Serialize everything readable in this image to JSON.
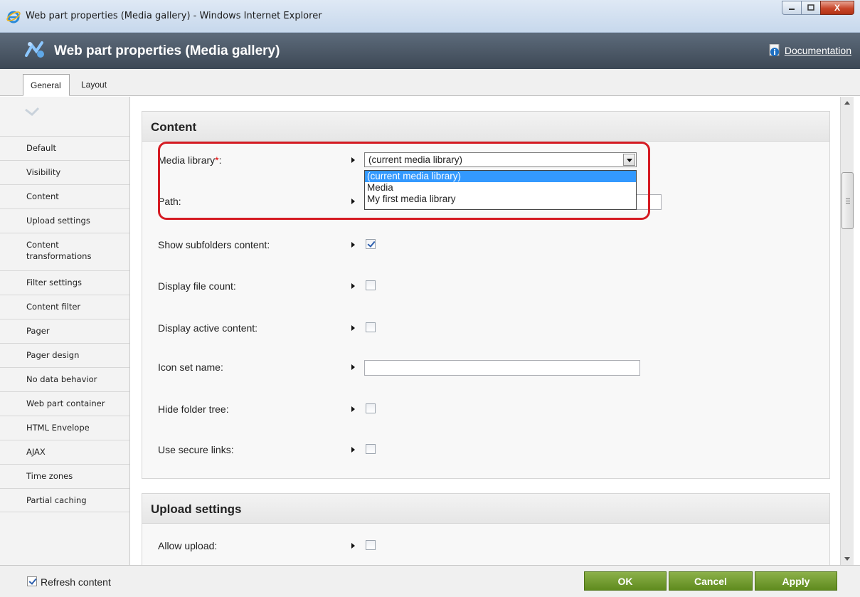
{
  "window": {
    "title": "Web part properties (Media gallery) - Windows Internet Explorer",
    "close_glyph": "X"
  },
  "header": {
    "title": "Web part properties (Media gallery)",
    "documentation_link": "Documentation"
  },
  "tabs": [
    {
      "label": "General",
      "active": true
    },
    {
      "label": "Layout",
      "active": false
    }
  ],
  "sidebar": {
    "items": [
      {
        "label": "Default"
      },
      {
        "label": "Visibility"
      },
      {
        "label": "Content"
      },
      {
        "label": "Upload settings"
      },
      {
        "label": "Content transformations"
      },
      {
        "label": "Filter settings"
      },
      {
        "label": "Content filter"
      },
      {
        "label": "Pager"
      },
      {
        "label": "Pager design"
      },
      {
        "label": "No data behavior"
      },
      {
        "label": "Web part container"
      },
      {
        "label": "HTML Envelope"
      },
      {
        "label": "AJAX"
      },
      {
        "label": "Time zones"
      },
      {
        "label": "Partial caching"
      }
    ]
  },
  "content": {
    "section_content": {
      "title": "Content",
      "media_library_label": "Media library",
      "required_mark": "*",
      "label_colon": ":",
      "media_library_value": "(current media library)",
      "media_library_options": [
        "(current media library)",
        "Media",
        "My first media library"
      ],
      "path_label": "Path:",
      "show_subfolders_label": "Show subfolders content:",
      "show_subfolders_checked": true,
      "display_file_count_label": "Display file count:",
      "display_file_count_checked": false,
      "display_active_content_label": "Display active content:",
      "display_active_content_checked": false,
      "icon_set_name_label": "Icon set name:",
      "icon_set_name_value": "",
      "hide_folder_tree_label": "Hide folder tree:",
      "hide_folder_tree_checked": false,
      "use_secure_links_label": "Use secure links:",
      "use_secure_links_checked": false
    },
    "section_upload": {
      "title": "Upload settings",
      "allow_upload_label": "Allow upload:",
      "allow_upload_checked": false
    }
  },
  "footer": {
    "refresh_label": "Refresh content",
    "refresh_checked": true,
    "ok_label": "OK",
    "cancel_label": "Cancel",
    "apply_label": "Apply"
  },
  "colors": {
    "header_bg": "#4a5664",
    "button_green": "#6f9a2a",
    "highlight_red": "#d51b23",
    "selection_blue": "#3399ff"
  }
}
